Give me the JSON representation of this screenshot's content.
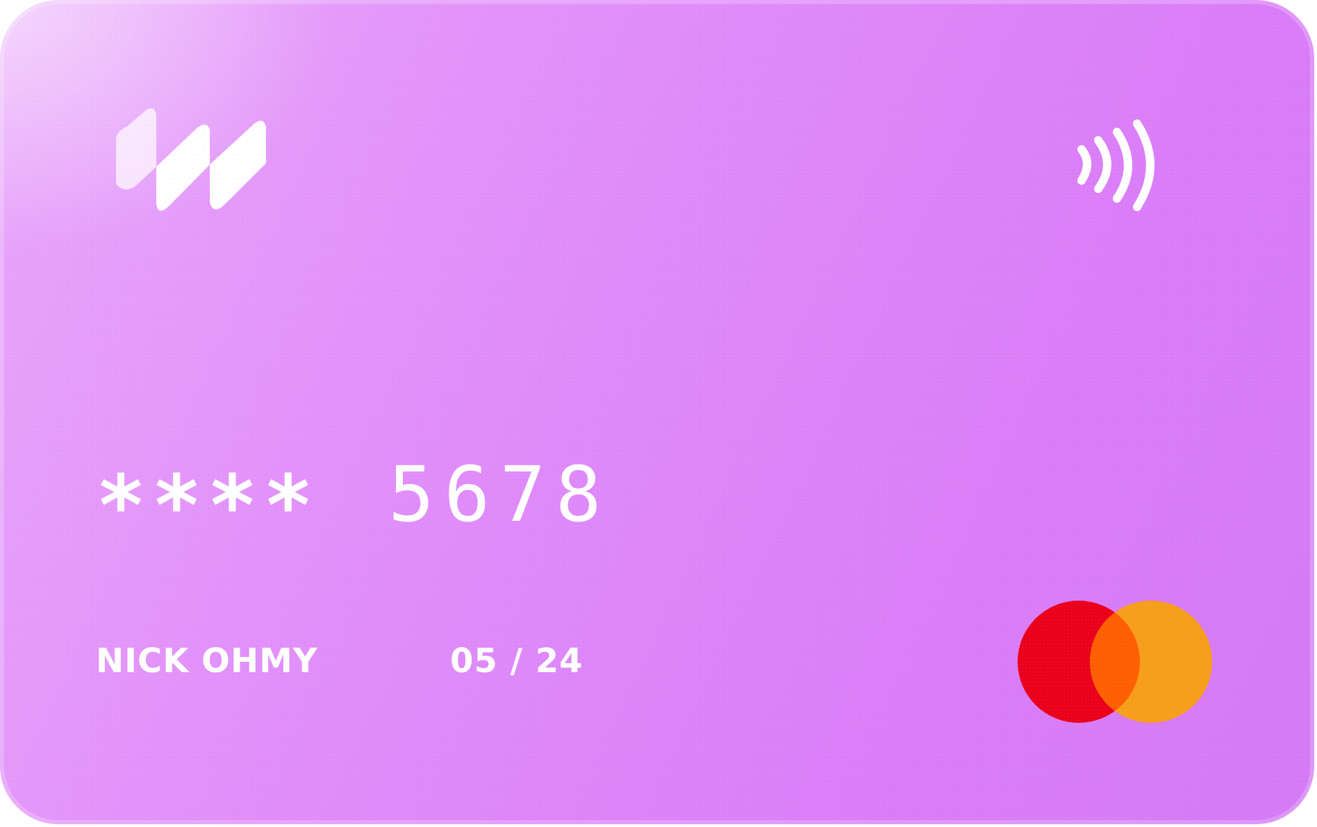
{
  "card": {
    "masked_digits": "****",
    "last_four": "5678",
    "holder_name": "NICK OHMY",
    "expiry": "05 / 24",
    "network_icon": "mastercard-icon",
    "contactless_icon": "contactless-icon",
    "logo_icon": "issuer-logo-icon"
  },
  "colors": {
    "card_gradient_start": "#e9a6fb",
    "card_gradient_end": "#d57af6",
    "text": "#ffffff",
    "mastercard_red": "#eb001b",
    "mastercard_orange": "#f79e1b",
    "mastercard_overlap": "#ff5f00"
  }
}
